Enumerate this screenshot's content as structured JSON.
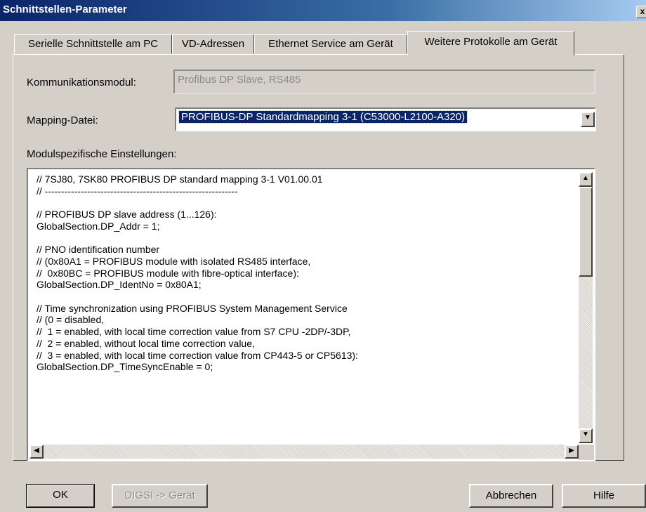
{
  "window": {
    "title": "Schnittstellen-Parameter",
    "close_label": "x"
  },
  "tabs": [
    {
      "label": "Serielle Schnittstelle am PC",
      "active": false
    },
    {
      "label": "VD-Adressen",
      "active": false
    },
    {
      "label": "Ethernet Service am Gerät",
      "active": false
    },
    {
      "label": "Weitere Protokolle am Gerät",
      "active": true
    }
  ],
  "form": {
    "module_label": "Kommunikationsmodul:",
    "module_value": "Profibus DP Slave, RS485",
    "mapping_label": "Mapping-Datei:",
    "mapping_value": "PROFIBUS-DP Standardmapping 3-1 (C53000-L2100-A320)",
    "settings_label": "Modulspezifische Einstellungen:"
  },
  "code_lines": [
    "// 7SJ80, 7SK80 PROFIBUS DP standard mapping 3-1 V01.00.01",
    "// -----------------------------------------------------------",
    "",
    "// PROFIBUS DP slave address (1...126):",
    "GlobalSection.DP_Addr = 1;",
    "",
    "// PNO identification number",
    "// (0x80A1 = PROFIBUS module with isolated RS485 interface,",
    "//  0x80BC = PROFIBUS module with fibre-optical interface):",
    "GlobalSection.DP_IdentNo = 0x80A1;",
    "",
    "// Time synchronization using PROFIBUS System Management Service",
    "// (0 = disabled,",
    "//  1 = enabled, with local time correction value from S7 CPU -2DP/-3DP,",
    "//  2 = enabled, without local time correction value,",
    "//  3 = enabled, with local time correction value from CP443-5 or CP5613):",
    "GlobalSection.DP_TimeSyncEnable = 0;"
  ],
  "buttons": {
    "ok": "OK",
    "digsi": "DIGSI -> Gerät",
    "cancel": "Abbrechen",
    "help": "Hilfe"
  },
  "scroll_glyphs": {
    "up": "▲",
    "down": "▼",
    "left": "◀",
    "right": "▶"
  }
}
